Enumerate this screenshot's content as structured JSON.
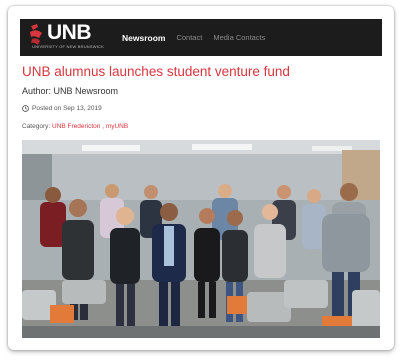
{
  "nav": {
    "logo_text": "UNB",
    "logo_subtitle": "UNIVERSITY OF NEW BRUNSWICK",
    "links": [
      "Newsroom",
      "Contact",
      "Media Contacts"
    ]
  },
  "article": {
    "title": "UNB alumnus launches student venture fund",
    "author": "Author: UNB Newsroom",
    "posted": "Posted on Sep 13, 2019",
    "category_label": "Category:",
    "category_links": "UNB Fredericton , myUNB"
  },
  "colors": {
    "brand_red": "#d8363f",
    "nav_bg": "#1c1c1c"
  },
  "icons": {
    "logo": "unb-logo-icon",
    "clock": "clock-icon"
  }
}
